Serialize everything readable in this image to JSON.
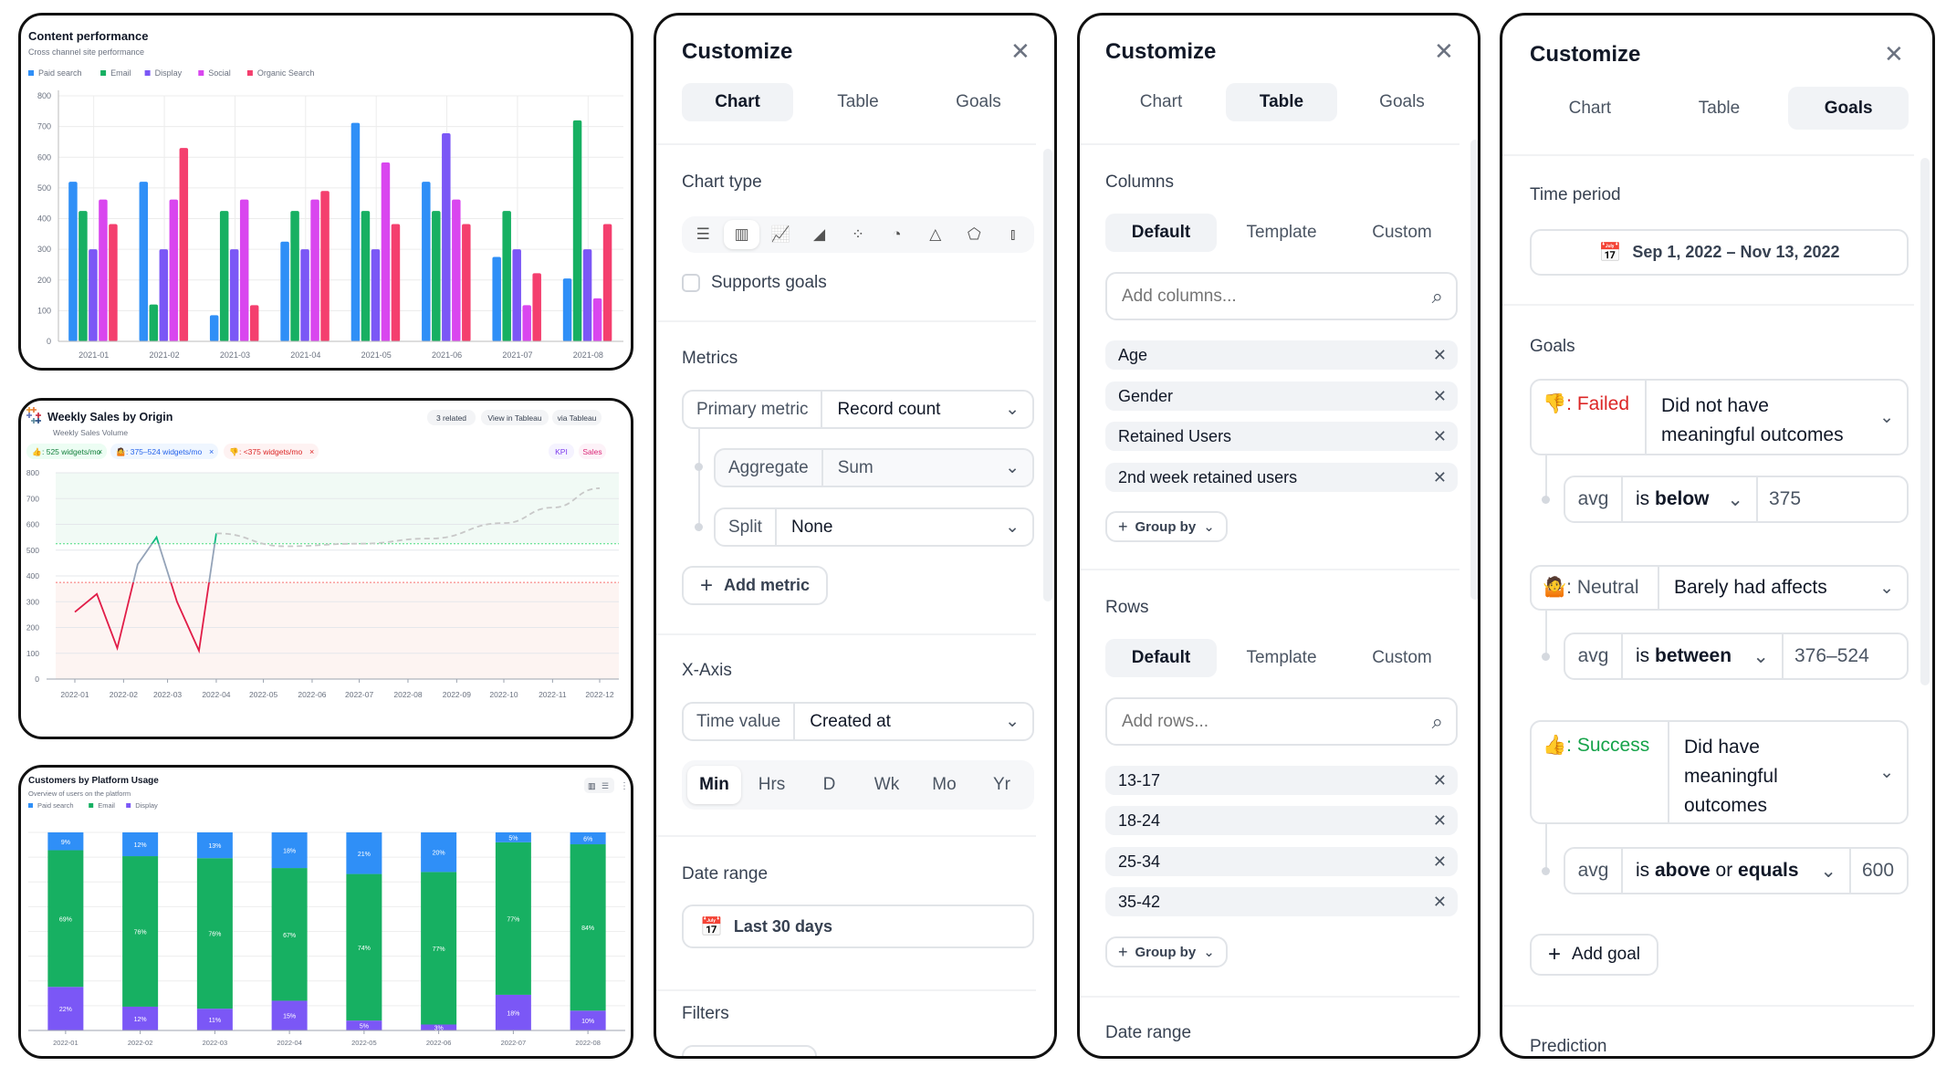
{
  "charts": [
    {
      "type": "bar",
      "title": "Content performance",
      "subtitle": "Cross channel site performance",
      "categories": [
        "2021-01",
        "2021-02",
        "2021-03",
        "2021-04",
        "2021-05",
        "2021-06",
        "2021-07",
        "2021-08"
      ],
      "ylim": [
        0,
        800
      ],
      "yticks": [
        0,
        100,
        200,
        300,
        400,
        500,
        600,
        700,
        800
      ],
      "grid": true,
      "legend_position": "top-left",
      "series": [
        {
          "name": "Paid search",
          "color": "#2f8ff7",
          "values": [
            520,
            520,
            85,
            325,
            712,
            520,
            275,
            205
          ]
        },
        {
          "name": "Email",
          "color": "#17b062",
          "values": [
            425,
            120,
            425,
            425,
            425,
            425,
            425,
            720
          ]
        },
        {
          "name": "Display",
          "color": "#7b57f6",
          "values": [
            300,
            300,
            300,
            300,
            300,
            678,
            300,
            300
          ]
        },
        {
          "name": "Social",
          "color": "#d946ef",
          "values": [
            462,
            462,
            462,
            462,
            583,
            462,
            118,
            140
          ]
        },
        {
          "name": "Organic Search",
          "color": "#f43f6e",
          "values": [
            382,
            630,
            118,
            490,
            382,
            382,
            222,
            382
          ]
        }
      ]
    },
    {
      "type": "line",
      "title": "Weekly Sales by Origin",
      "subtitle": "Weekly Sales Volume",
      "xticks": [
        "2022-01",
        "2022-02",
        "2022-03",
        "2022-04",
        "2022-05",
        "2022-06",
        "2022-07",
        "2022-08",
        "2022-09",
        "2022-10",
        "2022-11",
        "2022-12"
      ],
      "ylim": [
        0,
        800
      ],
      "yticks": [
        0,
        100,
        200,
        300,
        400,
        500,
        600,
        700,
        800
      ],
      "grid": true,
      "thresholds": {
        "success_min": 525,
        "failed_max": 375
      },
      "colors": {
        "failed": "#e11d48",
        "neutral": "#94a3b8",
        "success": "#10b981",
        "forecast": "#c8c8c8",
        "success_band": "#f1faf5",
        "failed_band": "#fdf4f2"
      },
      "actual": [
        {
          "x": "2022-01-01",
          "y": 260
        },
        {
          "x": "2022-01-15",
          "y": 330
        },
        {
          "x": "2022-01-28",
          "y": 120
        },
        {
          "x": "2022-02-10",
          "y": 445
        },
        {
          "x": "2022-02-22",
          "y": 550
        },
        {
          "x": "2022-03-07",
          "y": 300
        },
        {
          "x": "2022-03-21",
          "y": 110
        },
        {
          "x": "2022-04-01",
          "y": 565
        }
      ],
      "forecast": [
        {
          "x": "2022-04-01",
          "y": 565
        },
        {
          "x": "2022-05-15",
          "y": 515
        },
        {
          "x": "2022-07-01",
          "y": 525
        },
        {
          "x": "2022-08-15",
          "y": 545
        },
        {
          "x": "2022-10-01",
          "y": 605
        },
        {
          "x": "2022-11-01",
          "y": 665
        },
        {
          "x": "2022-12-01",
          "y": 740
        }
      ],
      "actions": [
        "3 related",
        "View in Tableau",
        "via Tableau"
      ],
      "goal_pills": [
        {
          "emoji": "👍",
          "label": ": 525 widgets/mo",
          "color": "#15803d",
          "bg": "#ecfdf3"
        },
        {
          "emoji": "🤷",
          "label": ": 375–524 widgets/mo",
          "color": "#2563eb",
          "bg": "#eff6ff"
        },
        {
          "emoji": "👎",
          "label": ": <375 widgets/mo",
          "color": "#dc2626",
          "bg": "#fef2f2"
        }
      ],
      "tags": [
        {
          "label": "KPI",
          "color": "#7c3aed",
          "bg": "#f5f3ff"
        },
        {
          "label": "Sales",
          "color": "#db2777",
          "bg": "#fdf2f8"
        }
      ]
    },
    {
      "type": "bar",
      "stacked": true,
      "title": "Customers by Platform Usage",
      "subtitle": "Overview of users on the platform",
      "categories": [
        "2022-01",
        "2022-02",
        "2022-03",
        "2022-04",
        "2022-05",
        "2022-06",
        "2022-07",
        "2022-08"
      ],
      "ylim": [
        0,
        100
      ],
      "unit": "%",
      "grid": true,
      "legend_position": "top-left",
      "series": [
        {
          "name": "Paid search",
          "color": "#2f8ff7",
          "values": [
            9,
            12,
            13,
            18,
            21,
            20,
            5,
            6
          ]
        },
        {
          "name": "Email",
          "color": "#17b062",
          "values": [
            69,
            76,
            76,
            67,
            74,
            77,
            77,
            84
          ]
        },
        {
          "name": "Display",
          "color": "#7b57f6",
          "values": [
            22,
            12,
            11,
            15,
            5,
            3,
            18,
            10
          ]
        }
      ]
    }
  ],
  "chart_panel": {
    "title": "Customize",
    "tabs": [
      "Chart",
      "Table",
      "Goals"
    ],
    "selected_tab": "Chart",
    "chart_type_label": "Chart type",
    "chart_types": [
      "horizontal-bar",
      "vertical-bar",
      "line",
      "area",
      "scatter",
      "pie",
      "pyramid",
      "radar",
      "candlestick"
    ],
    "selected_chart_type": "vertical-bar",
    "supports_goals": {
      "label": "Supports goals",
      "checked": false
    },
    "metrics_label": "Metrics",
    "primary_metric": {
      "label": "Primary metric",
      "value": "Record count"
    },
    "aggregate": {
      "label": "Aggregate",
      "value": "Sum"
    },
    "split": {
      "label": "Split",
      "value": "None"
    },
    "add_metric": "Add metric",
    "xaxis_label": "X-Axis",
    "time_value": {
      "label": "Time value",
      "value": "Created at"
    },
    "granularity": [
      "Min",
      "Hrs",
      "D",
      "Wk",
      "Mo",
      "Yr"
    ],
    "selected_granularity": "Min",
    "date_range_label": "Date range",
    "date_range": "Last 30 days",
    "filters_label": "Filters"
  },
  "table_panel": {
    "title": "Customize",
    "tabs": [
      "Chart",
      "Table",
      "Goals"
    ],
    "selected_tab": "Table",
    "columns_label": "Columns",
    "column_modes": [
      "Default",
      "Template",
      "Custom"
    ],
    "columns_placeholder": "Add columns...",
    "columns": [
      "Age",
      "Gender",
      "Retained Users",
      "2nd week retained users"
    ],
    "group_by": "Group by",
    "rows_label": "Rows",
    "row_modes": [
      "Default",
      "Template",
      "Custom"
    ],
    "rows_placeholder": "Add rows...",
    "rows": [
      "13-17",
      "18-24",
      "25-34",
      "35-42"
    ],
    "date_range_label": "Date range"
  },
  "goals_panel": {
    "title": "Customize",
    "tabs": [
      "Chart",
      "Table",
      "Goals"
    ],
    "selected_tab": "Goals",
    "time_period_label": "Time period",
    "time_period": "Sep 1, 2022 – Nov 13, 2022",
    "goals_label": "Goals",
    "goals": [
      {
        "emoji": "👎",
        "status": ": Failed",
        "color": "#dc2626",
        "description": "Did not have meaningful outcomes",
        "agg": "avg",
        "op_pre": "is ",
        "op_bold": "below",
        "op_post": "",
        "op_bold2": "",
        "value": "375"
      },
      {
        "emoji": "🤷",
        "status": ": Neutral",
        "color": "#4b5563",
        "description": "Barely had affects",
        "agg": "avg",
        "op_pre": "is ",
        "op_bold": "between",
        "op_post": "",
        "op_bold2": "",
        "value": "376–524"
      },
      {
        "emoji": "👍",
        "status": ": Success",
        "color": "#16a34a",
        "description": "Did have meaningful outcomes",
        "agg": "avg",
        "op_pre": "is ",
        "op_bold": "above",
        "op_post": " or ",
        "op_bold2": "equals",
        "value": "600"
      }
    ],
    "add_goal": "Add goal",
    "prediction_label": "Prediction"
  }
}
